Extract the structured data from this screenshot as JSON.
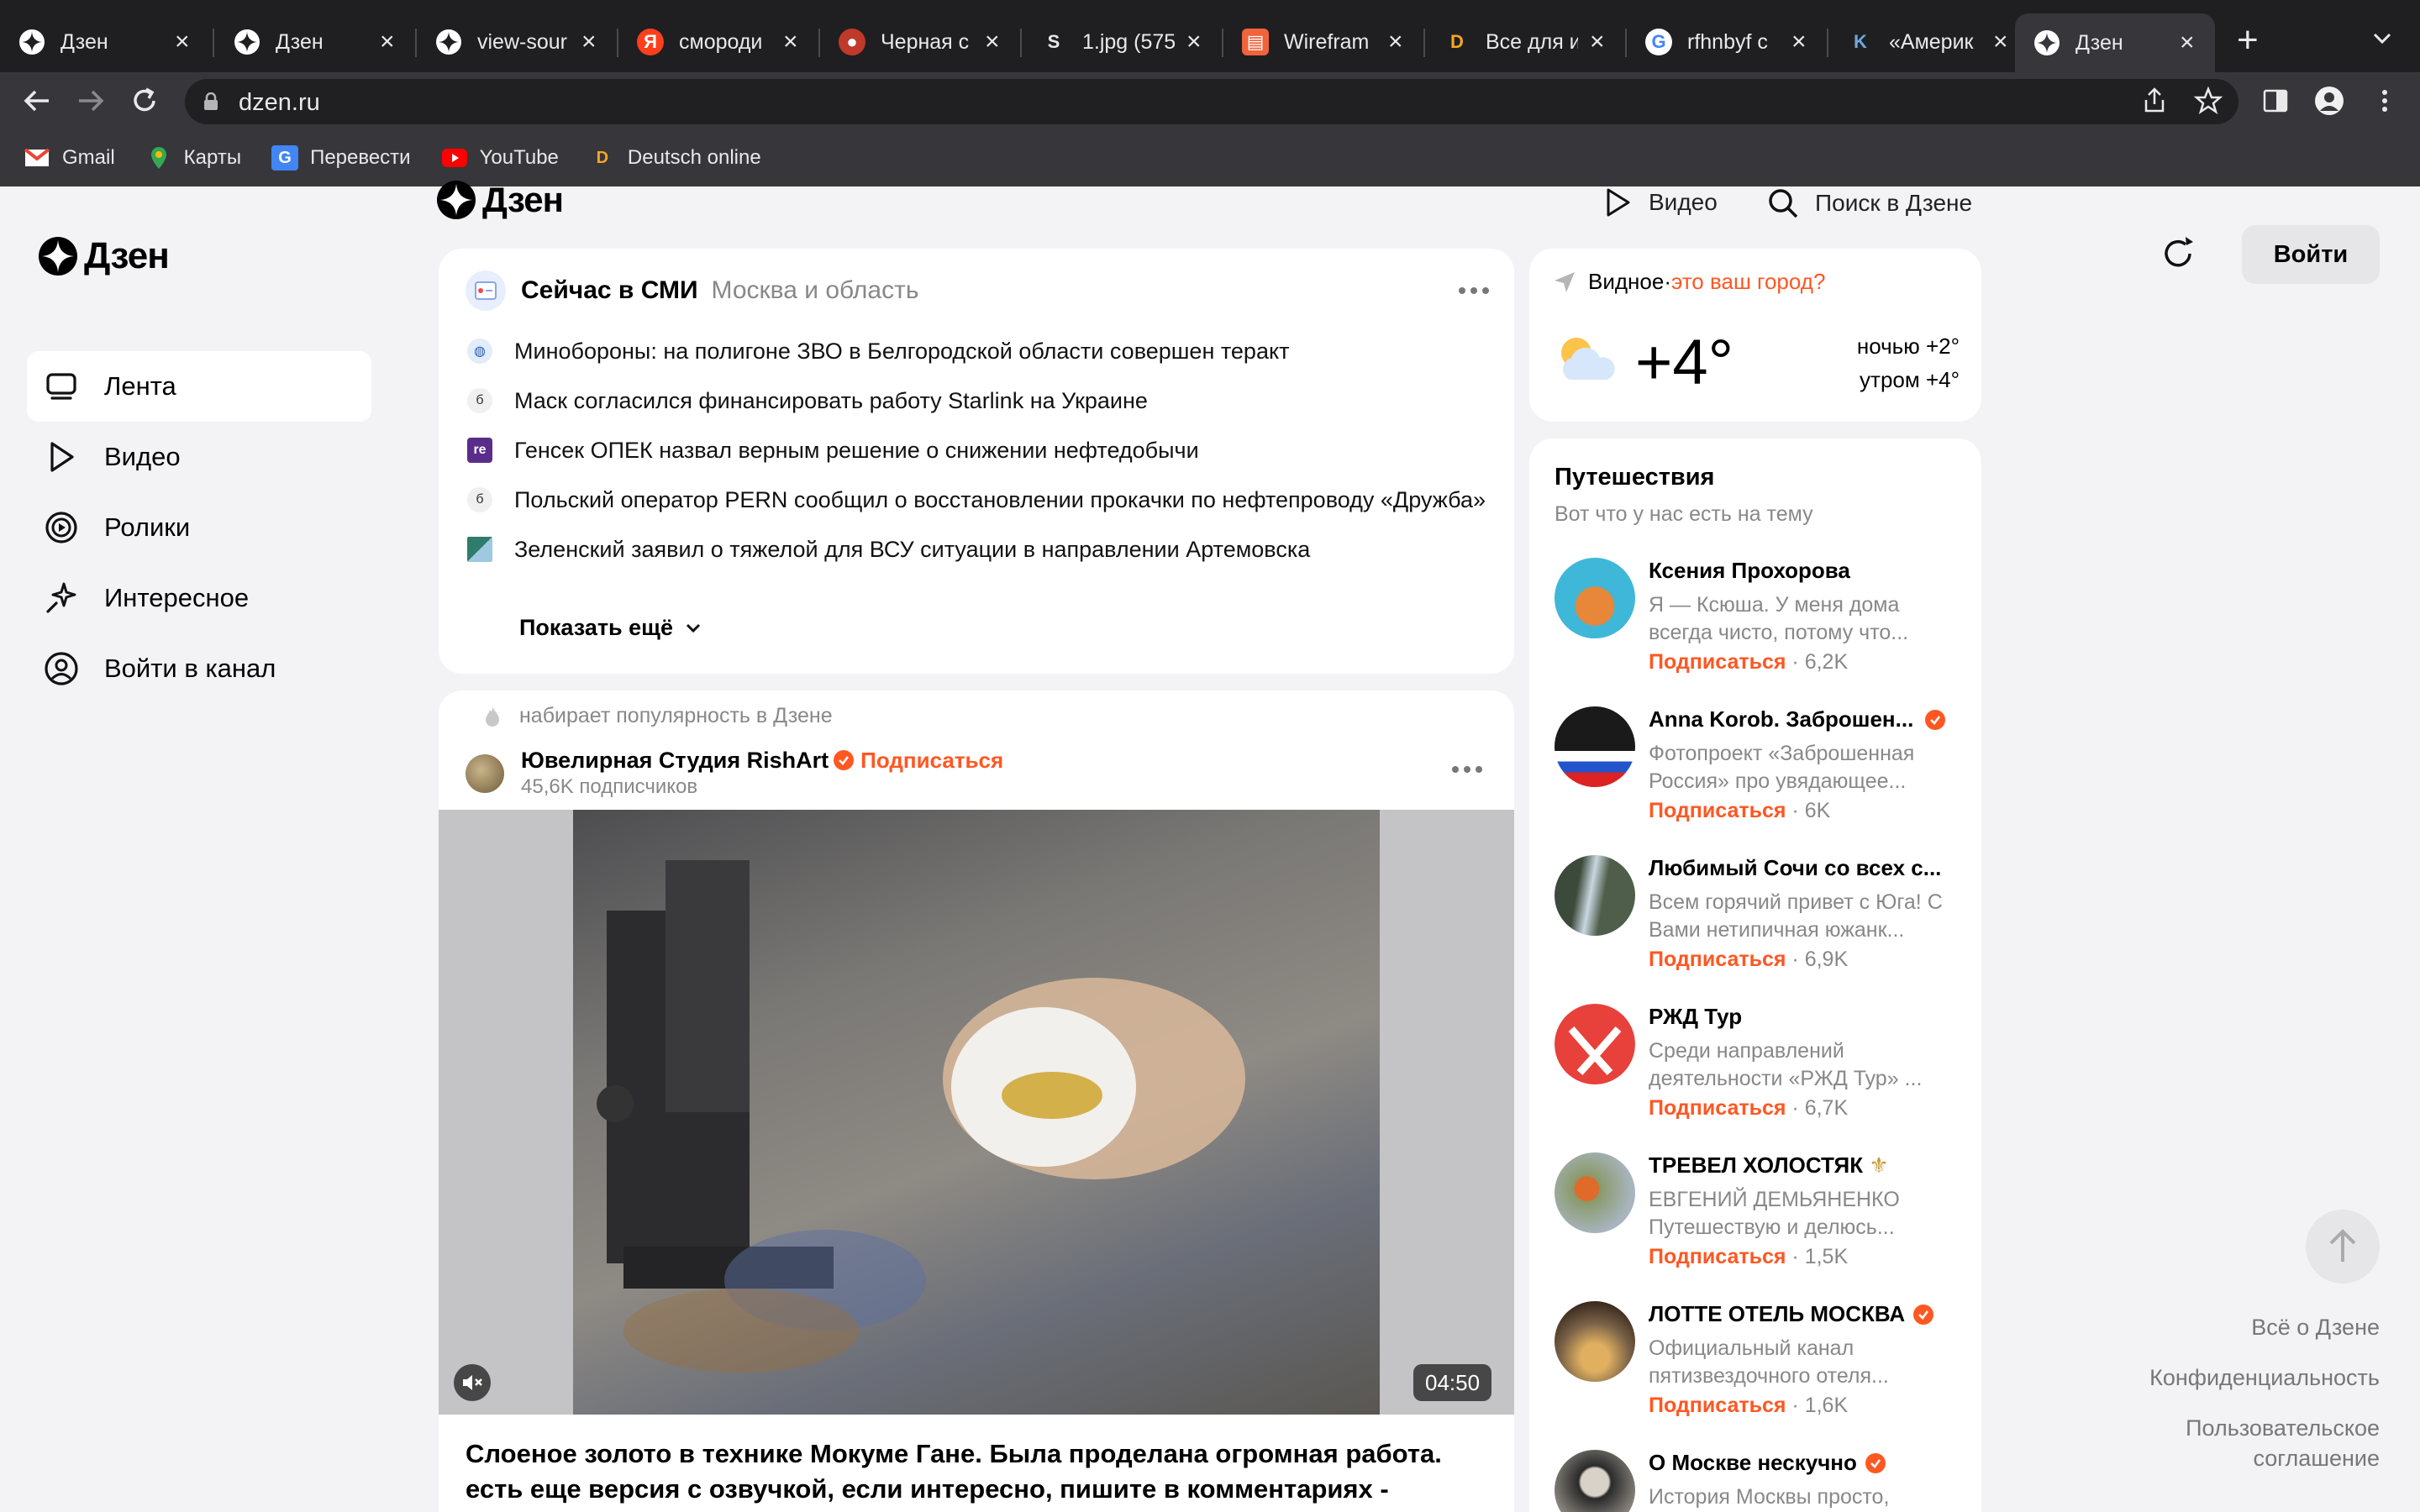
{
  "browser": {
    "tabs": [
      {
        "title": "Дзен",
        "favicon": "dzen-icon"
      },
      {
        "title": "Дзен",
        "favicon": "dzen-icon"
      },
      {
        "title": "view-sour",
        "favicon": "dzen-icon"
      },
      {
        "title": "смороди",
        "favicon": "yandex-icon"
      },
      {
        "title": "Черная с",
        "favicon": "site-icon"
      },
      {
        "title": "1.jpg (575",
        "favicon": "s-icon"
      },
      {
        "title": "Wirefram",
        "favicon": "wireframe-icon"
      },
      {
        "title": "Все для и",
        "favicon": "deutsch-icon"
      },
      {
        "title": "rfhnbyf c",
        "favicon": "google-icon"
      },
      {
        "title": "«Америк",
        "favicon": "k-icon"
      },
      {
        "title": "Дзен",
        "favicon": "dzen-icon"
      }
    ],
    "url": "dzen.ru",
    "bookmarks": [
      {
        "label": "Gmail"
      },
      {
        "label": "Карты"
      },
      {
        "label": "Перевести"
      },
      {
        "label": "YouTube"
      },
      {
        "label": "Deutsch online"
      }
    ]
  },
  "header": {
    "logo": "Дзен",
    "video": "Видео",
    "search": "Поиск в Дзене",
    "login": "Войти"
  },
  "nav": {
    "items": [
      {
        "label": "Лента",
        "icon": "feed-icon"
      },
      {
        "label": "Видео",
        "icon": "play-icon"
      },
      {
        "label": "Ролики",
        "icon": "clips-icon"
      },
      {
        "label": "Интересное",
        "icon": "sparkle-icon"
      },
      {
        "label": "Войти в канал",
        "icon": "user-circle-icon"
      }
    ]
  },
  "news": {
    "title": "Сейчас в СМИ",
    "region": "Москва и область",
    "items": [
      {
        "text": "Минобороны: на полигоне ЗВО в Белгородской области совершен теракт",
        "icon": "mil-icon"
      },
      {
        "text": "Маск согласился финансировать работу Starlink на Украине",
        "icon": "source-icon"
      },
      {
        "text": "Генсек ОПЕК назвал верным решение о снижении нефтедобычи",
        "icon": "re-icon"
      },
      {
        "text": "Польский оператор PERN сообщил о восстановлении прокачки по нефтепроводу «Дружба»",
        "icon": "source-icon"
      },
      {
        "text": "Зеленский заявил о тяжелой для ВСУ ситуации в направлении Артемовска",
        "icon": "flag-icon"
      }
    ],
    "show_more": "Показать ещё"
  },
  "post": {
    "trend": "набирает популярность в Дзене",
    "author": "Ювелирная Студия RishArt",
    "subscribe": "Подписаться",
    "subscribers": "45,6K подписчиков",
    "duration": "04:50",
    "title": "Слоеное золото в технике Мокуме Гане. Была проделана огромная работа. есть еще версия с озвучкой, если интересно, пишите в комментариях -"
  },
  "weather": {
    "city": "Видное",
    "separator": " · ",
    "question": "это ваш город?",
    "temp": "+4°",
    "night": "ночью +2°",
    "morning": "утром +4°"
  },
  "travel": {
    "title": "Путешествия",
    "subtitle": "Вот что у нас есть на тему",
    "subscribe_label": "Подписаться",
    "channels": [
      {
        "name": "Ксения Прохорова",
        "desc": "Я — Ксюша. У меня дома всегда чисто, потому что...",
        "count": "6,2K",
        "verified": false,
        "color": "#3fb7d8"
      },
      {
        "name": "Anna Korob. Заброшен...",
        "desc": "Фотопроект «Заброшенная Россия» про увядающее...",
        "count": "6K",
        "verified": true,
        "color": "#1a1a1a"
      },
      {
        "name": "Любимый Сочи со всех с...",
        "desc": "Всем горячий привет с Юга! С Вами нетипичная южанк...",
        "count": "6,9K",
        "verified": false,
        "color": "#5a6a5a"
      },
      {
        "name": "РЖД Тур",
        "desc": "Среди направлений деятельности «РЖД Тур» ...",
        "count": "6,7K",
        "verified": false,
        "color": "#e8403a"
      },
      {
        "name": "ТРЕВЕЛ ХОЛОСТЯК",
        "desc": "ЕВГЕНИЙ ДЕМЬЯНЕНКО Путешествую и делюсь...",
        "count": "1,5K",
        "verified": false,
        "color": "#8a9a6a"
      },
      {
        "name": "ЛОТТЕ ОТЕЛЬ МОСКВА",
        "desc": "Официальный канал пятизвездочного отеля...",
        "count": "1,6K",
        "verified": true,
        "color": "#7a6248"
      },
      {
        "name": "О Москве нескучно",
        "desc": "История Москвы просто,",
        "count": "",
        "verified": true,
        "color": "#2a2a2a"
      }
    ]
  },
  "footer": {
    "about": "Всё о Дзене",
    "privacy": "Конфиденциальность",
    "terms": "Пользовательское соглашение"
  },
  "colors": {
    "accent": "#ff5722",
    "chrome_dark": "#1f1f22",
    "chrome_toolbar": "#36363b",
    "page_bg": "#f3f3f5"
  }
}
